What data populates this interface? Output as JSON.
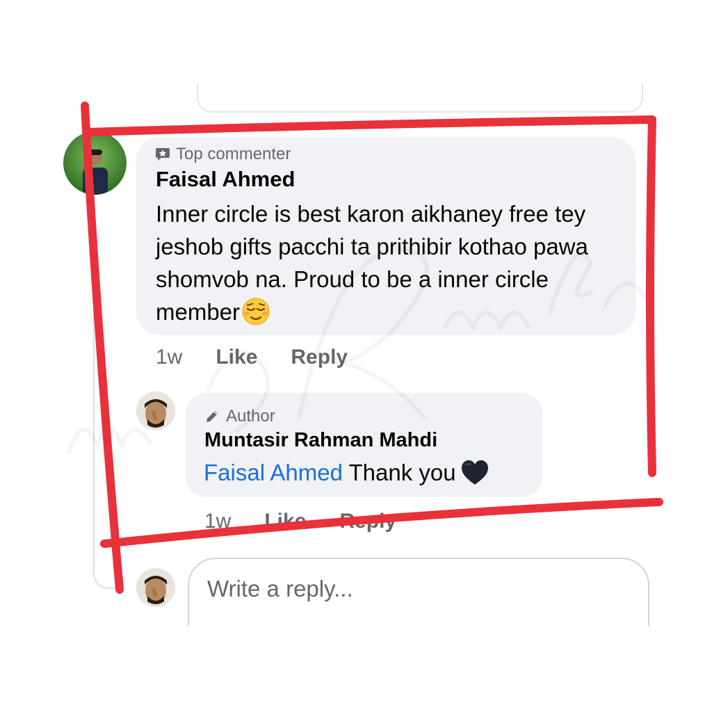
{
  "comment": {
    "badge": "Top commenter",
    "badge_icon": "star-chat-icon",
    "author": "Faisal Ahmed",
    "text": "Inner circle is best karon aikhaney free tey jeshob gifts pacchi ta prithibir kothao pawa shomvob na. Proud to be a inner circle member",
    "emoji": "relieved-face",
    "time": "1w",
    "like_label": "Like",
    "reply_label": "Reply"
  },
  "reply": {
    "badge": "Author",
    "badge_icon": "pencil-icon",
    "author": "Muntasir Rahman Mahdi",
    "mention": "Faisal Ahmed",
    "text": "Thank you",
    "emoji": "black-heart",
    "time": "1w",
    "like_label": "Like",
    "reply_label": "Reply"
  },
  "composer": {
    "placeholder": "Write a reply..."
  },
  "colors": {
    "bubble": "#f0f2f5",
    "secondary_text": "#65676b",
    "mention": "#1d6fd6",
    "annotation": "#e8313a"
  }
}
